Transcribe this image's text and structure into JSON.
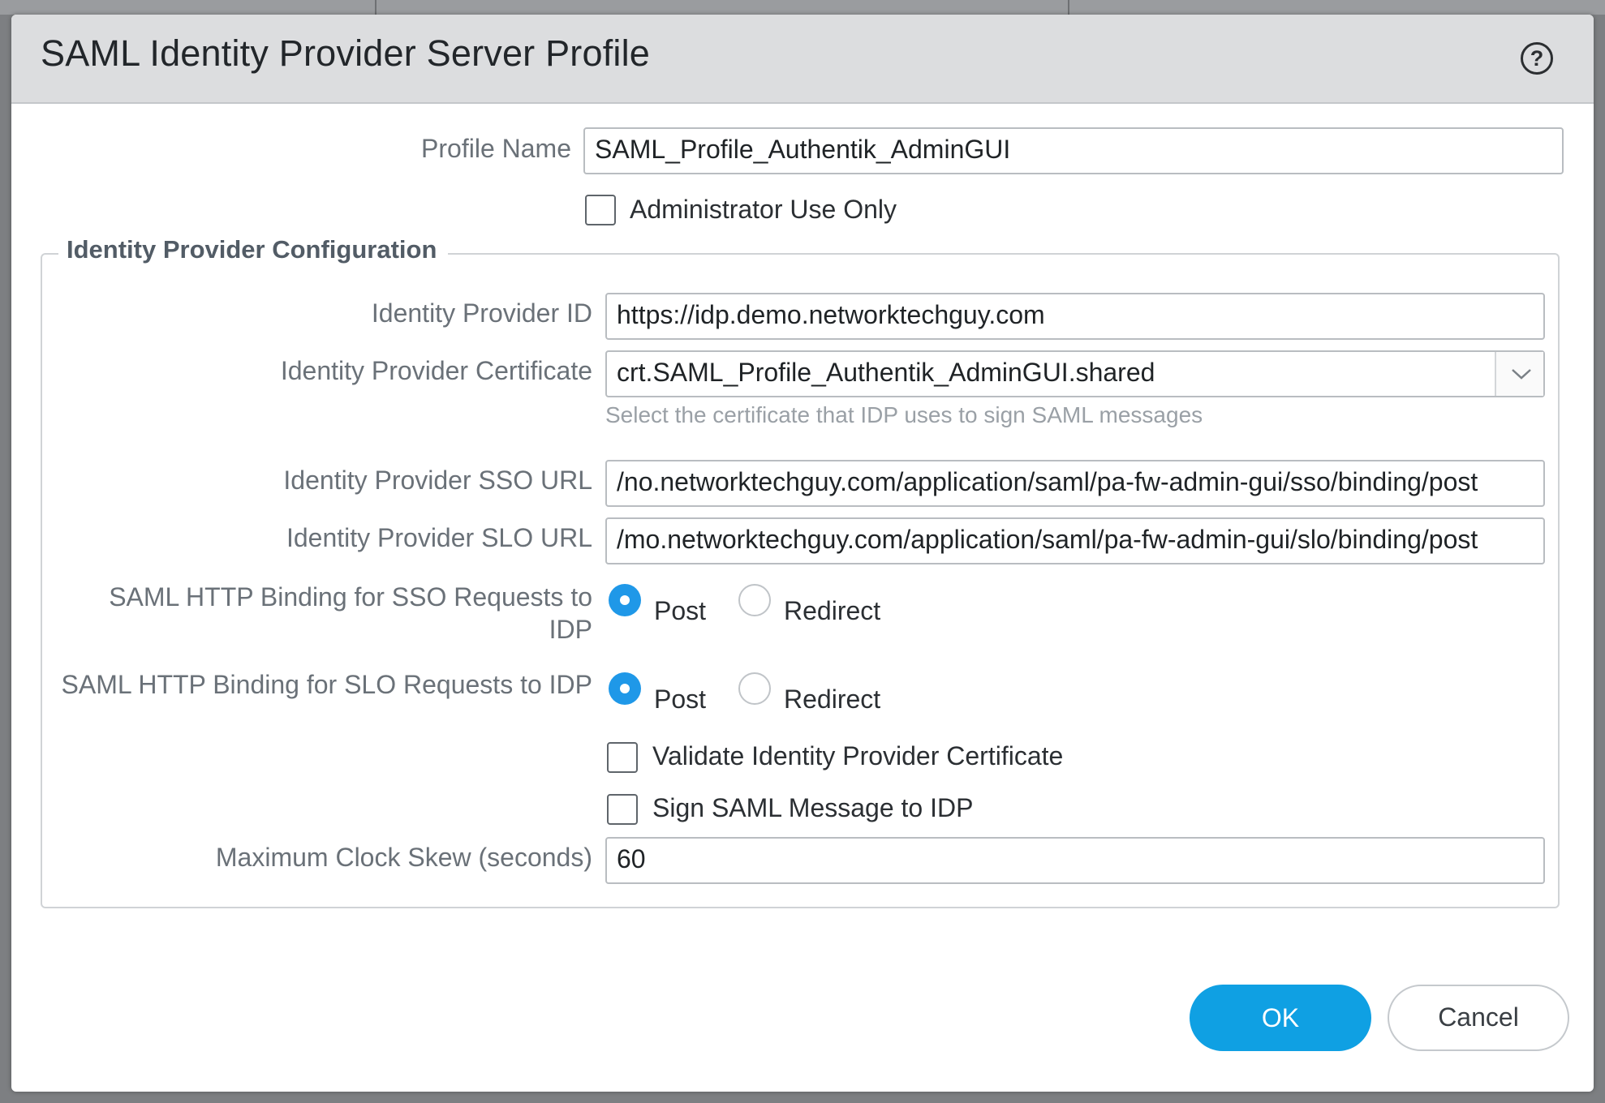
{
  "dialog": {
    "title": "SAML Identity Provider Server Profile",
    "help_icon": "help-circle-icon",
    "help_glyph": "?"
  },
  "profile": {
    "name_label": "Profile Name",
    "name_value": "SAML_Profile_Authentik_AdminGUI",
    "admin_only_label": "Administrator Use Only",
    "admin_only_checked": false
  },
  "idp_config": {
    "legend": "Identity Provider Configuration",
    "id_label": "Identity Provider ID",
    "id_value": "https://idp.demo.networktechguy.com",
    "cert_label": "Identity Provider Certificate",
    "cert_value": "crt.SAML_Profile_Authentik_AdminGUI.shared",
    "cert_hint": "Select the certificate that IDP uses to sign SAML messages",
    "cert_dropdown_icon": "chevron-down-icon",
    "sso_url_label": "Identity Provider SSO URL",
    "sso_url_value": "no.networktechguy.com/application/saml/pa-fw-admin-gui/sso/binding/post/",
    "slo_url_label": "Identity Provider SLO URL",
    "slo_url_value": "mo.networktechguy.com/application/saml/pa-fw-admin-gui/slo/binding/post/",
    "sso_binding_label_line1": "SAML HTTP Binding for SSO Requests to",
    "sso_binding_label_line2": "IDP",
    "sso_binding_selected": "Post",
    "slo_binding_label": "SAML HTTP Binding for SLO Requests to IDP",
    "slo_binding_selected": "Post",
    "option_post": "Post",
    "option_redirect": "Redirect",
    "validate_cert_label": "Validate Identity Provider Certificate",
    "validate_cert_checked": false,
    "sign_msg_label": "Sign SAML Message to IDP",
    "sign_msg_checked": false,
    "clock_skew_label": "Maximum Clock Skew (seconds)",
    "clock_skew_value": "60"
  },
  "buttons": {
    "ok": "OK",
    "cancel": "Cancel"
  },
  "colors": {
    "accent": "#1f98e8",
    "ok_button": "#0fa0e3",
    "header_bg": "#dcdddf"
  }
}
